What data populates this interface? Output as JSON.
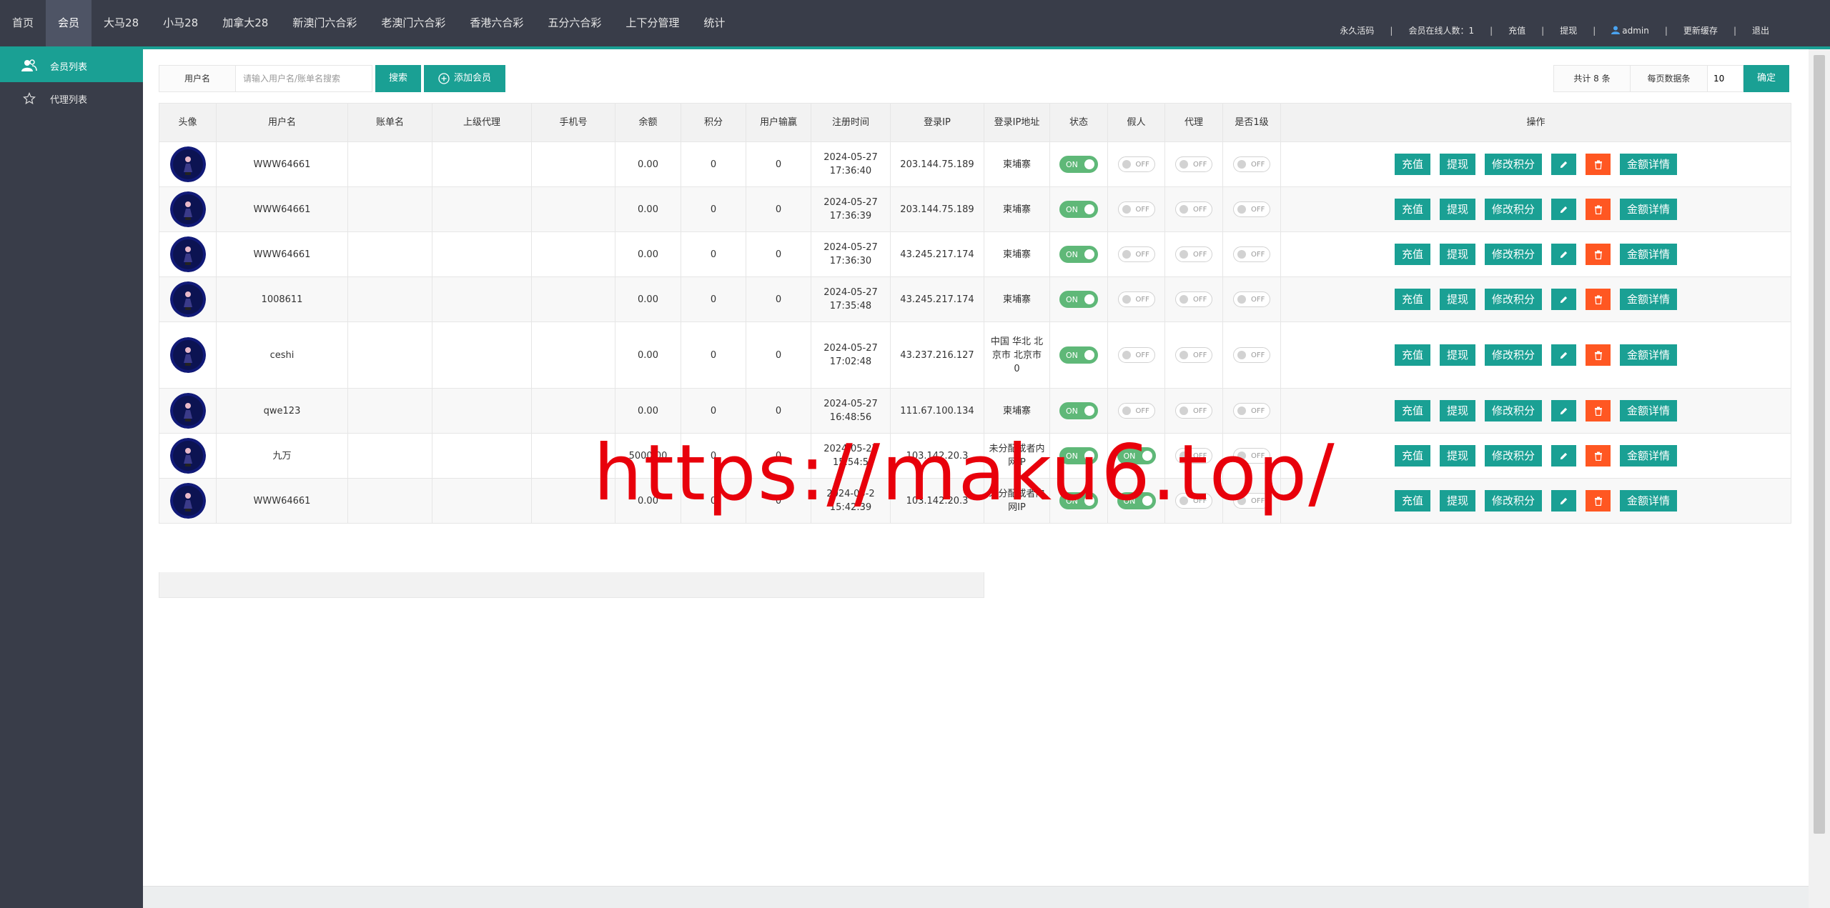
{
  "nav": {
    "items": [
      "首页",
      "会员",
      "大马28",
      "小马28",
      "加拿大28",
      "新澳门六合彩",
      "老澳门六合彩",
      "香港六合彩",
      "五分六合彩",
      "上下分管理",
      "统计"
    ],
    "active_index": 1,
    "right": {
      "activation": "永久活码",
      "online": "会员在线人数：1",
      "recharge": "充值",
      "withdraw": "提现",
      "user": "admin",
      "clear_cache": "更新缓存",
      "logout": "退出"
    }
  },
  "sidebar": {
    "items": [
      {
        "label": "会员列表",
        "icon": "users-icon",
        "active": true
      },
      {
        "label": "代理列表",
        "icon": "star-icon",
        "active": false
      }
    ]
  },
  "search": {
    "label": "用户名",
    "placeholder": "请输入用户名/账单名搜索",
    "search_btn": "搜索",
    "add_btn": "添加会员"
  },
  "pager": {
    "total": "共计 8 条",
    "per_page_label": "每页数据条",
    "per_page_value": "10",
    "ok_btn": "确定"
  },
  "table": {
    "headers": [
      "头像",
      "用户名",
      "账单名",
      "上级代理",
      "手机号",
      "余额",
      "积分",
      "用户输赢",
      "注册时间",
      "登录IP",
      "登录IP地址",
      "状态",
      "假人",
      "代理",
      "是否1级",
      "操作"
    ],
    "on_label": "ON",
    "off_label": "OFF",
    "op_labels": {
      "recharge": "充值",
      "withdraw": "提现",
      "edit_points": "修改积分",
      "details": "金额详情"
    },
    "rows": [
      {
        "username": "WWW64661",
        "billname": "",
        "agent": "",
        "phone": "",
        "balance": "0.00",
        "points": "0",
        "winloss": "0",
        "reg_date": "2024-05-27",
        "reg_time": "17:36:40",
        "ip": "203.144.75.189",
        "location": "柬埔寨",
        "status": true,
        "fake": false,
        "proxy": false,
        "level1": false
      },
      {
        "username": "WWW64661",
        "billname": "",
        "agent": "",
        "phone": "",
        "balance": "0.00",
        "points": "0",
        "winloss": "0",
        "reg_date": "2024-05-27",
        "reg_time": "17:36:39",
        "ip": "203.144.75.189",
        "location": "柬埔寨",
        "status": true,
        "fake": false,
        "proxy": false,
        "level1": false
      },
      {
        "username": "WWW64661",
        "billname": "",
        "agent": "",
        "phone": "",
        "balance": "0.00",
        "points": "0",
        "winloss": "0",
        "reg_date": "2024-05-27",
        "reg_time": "17:36:30",
        "ip": "43.245.217.174",
        "location": "柬埔寨",
        "status": true,
        "fake": false,
        "proxy": false,
        "level1": false
      },
      {
        "username": "1008611",
        "billname": "",
        "agent": "",
        "phone": "",
        "balance": "0.00",
        "points": "0",
        "winloss": "0",
        "reg_date": "2024-05-27",
        "reg_time": "17:35:48",
        "ip": "43.245.217.174",
        "location": "柬埔寨",
        "status": true,
        "fake": false,
        "proxy": false,
        "level1": false
      },
      {
        "username": "ceshi",
        "billname": "",
        "agent": "",
        "phone": "",
        "balance": "0.00",
        "points": "0",
        "winloss": "0",
        "reg_date": "2024-05-27",
        "reg_time": "17:02:48",
        "ip": "43.237.216.127",
        "location": "中国 华北 北京市 北京市 0",
        "status": true,
        "fake": false,
        "proxy": false,
        "level1": false
      },
      {
        "username": "qwe123",
        "billname": "",
        "agent": "",
        "phone": "",
        "balance": "0.00",
        "points": "0",
        "winloss": "0",
        "reg_date": "2024-05-27",
        "reg_time": "16:48:56",
        "ip": "111.67.100.134",
        "location": "柬埔寨",
        "status": true,
        "fake": false,
        "proxy": false,
        "level1": false
      },
      {
        "username": "九万",
        "billname": "",
        "agent": "",
        "phone": "",
        "balance": "5000.00",
        "points": "0",
        "winloss": "0",
        "reg_date": "2024-05-27",
        "reg_time": "15:54:5",
        "ip": "103.142.20.3",
        "location": "未分配或者内网IP",
        "status": true,
        "fake": true,
        "proxy": false,
        "level1": false
      },
      {
        "username": "WWW64661",
        "billname": "",
        "agent": "",
        "phone": "",
        "balance": "0.00",
        "points": "0",
        "winloss": "0",
        "reg_date": "2024-05-2",
        "reg_time": "15:42:39",
        "ip": "103.142.20.3",
        "location": "未分配或者内网IP",
        "status": true,
        "fake": true,
        "proxy": false,
        "level1": false
      }
    ]
  },
  "watermark": "https://maku6.top/",
  "colors": {
    "teal": "#1aa094",
    "dark": "#393d49",
    "danger": "#ff5722",
    "switch_on": "#5fb878"
  }
}
